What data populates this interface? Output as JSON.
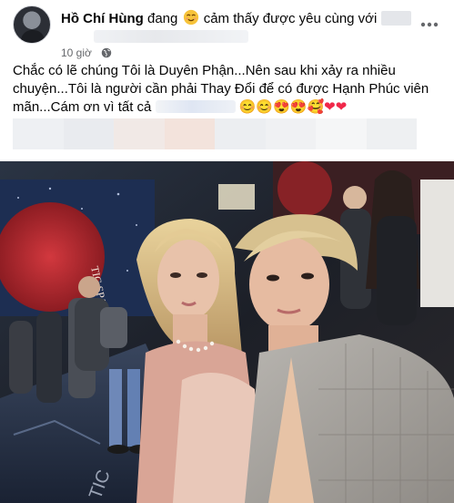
{
  "post": {
    "author": "Hồ Chí Hùng",
    "feeling_prefix": "đang",
    "feeling_text": "cảm thấy được yêu cùng với",
    "feeling_emoji": "relieved-face-emoji",
    "timestamp": "10 giờ",
    "privacy_icon": "globe-icon",
    "more_icon": "more-horizontal-icon",
    "body_text": "Chắc có lẽ chúng Tôi là Duyên Phận...Nên sau khi xảy ra nhiều chuyện...Tôi là người cần phải Thay Đổi để có được Hạnh Phúc viên mãn...Cám ơn vì tất cả",
    "body_emojis": [
      "😊",
      "😊",
      "😍",
      "😍",
      "🥰",
      "❤",
      "❤"
    ],
    "photo_sign_text": "TIC SPACE",
    "photo_floor_text": "TIC"
  },
  "colors": {
    "text": "#050505",
    "secondary_text": "#65676b",
    "heart": "#f02849",
    "photo_bg_red": "#b3262d"
  }
}
